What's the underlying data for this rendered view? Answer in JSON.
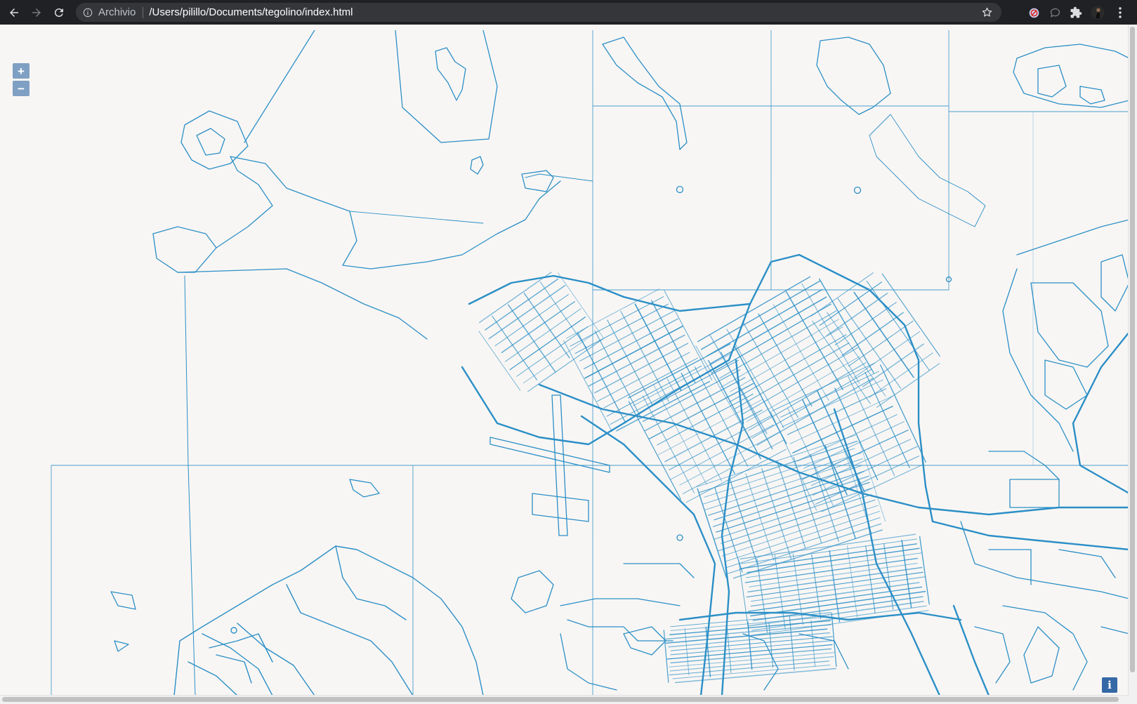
{
  "browser": {
    "scheme_label": "Archivio",
    "url": "/Users/pilillo/Documents/tegolino/index.html",
    "icons": [
      "back-arrow-icon",
      "forward-arrow-icon",
      "reload-icon",
      "info-icon",
      "star-icon",
      "blocked-extension-icon",
      "chat-extension-icon",
      "puzzle-extension-icon",
      "profile-avatar-icon",
      "more-vert-icon"
    ]
  },
  "map": {
    "zoom_in_label": "+",
    "zoom_out_label": "−",
    "info_label": "i",
    "line_color": "#2b8fc7",
    "background_color": "#f8f6f4"
  }
}
